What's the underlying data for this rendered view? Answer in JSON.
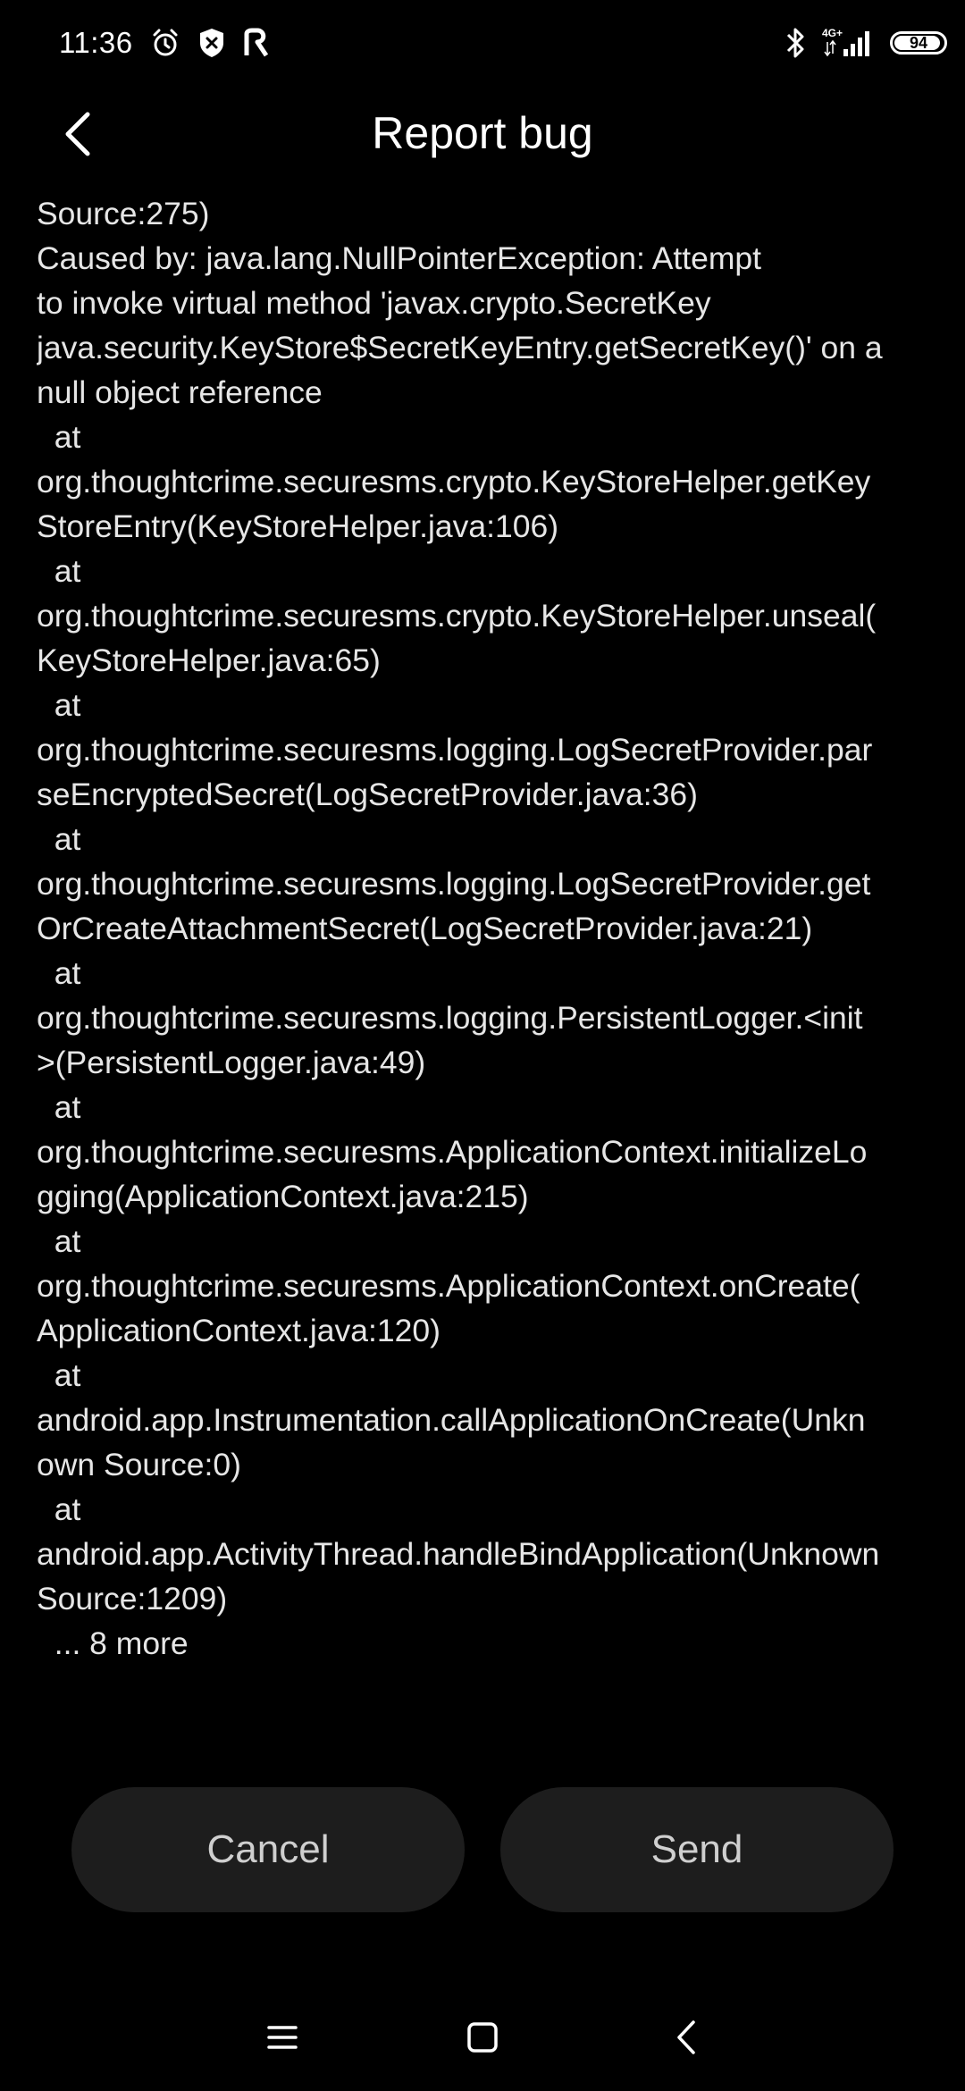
{
  "status_bar": {
    "time": "11:36",
    "battery_level": "94",
    "network": "4G+",
    "left_icons": [
      "alarm-icon",
      "shield-icon",
      "app-icon"
    ],
    "right_icons": [
      "bluetooth-icon",
      "signal-icon",
      "battery-icon"
    ]
  },
  "header": {
    "title": "Report bug",
    "back_icon": "chevron-left-icon"
  },
  "log": {
    "lines": [
      "Source:275)",
      "Caused by: java.lang.NullPointerException: Attempt",
      "to invoke virtual method 'javax.crypto.SecretKey",
      "java.security.KeyStore$SecretKeyEntry.getSecretKey()' on a",
      "null object reference",
      "  at",
      "org.thoughtcrime.securesms.crypto.KeyStoreHelper.getKey",
      "StoreEntry(KeyStoreHelper.java:106)",
      "  at",
      "org.thoughtcrime.securesms.crypto.KeyStoreHelper.unseal(",
      "KeyStoreHelper.java:65)",
      "  at",
      "org.thoughtcrime.securesms.logging.LogSecretProvider.par",
      "seEncryptedSecret(LogSecretProvider.java:36)",
      "  at",
      "org.thoughtcrime.securesms.logging.LogSecretProvider.get",
      "OrCreateAttachmentSecret(LogSecretProvider.java:21)",
      "  at",
      "org.thoughtcrime.securesms.logging.PersistentLogger.<init",
      ">(PersistentLogger.java:49)",
      "  at",
      "org.thoughtcrime.securesms.ApplicationContext.initializeLo",
      "gging(ApplicationContext.java:215)",
      "  at",
      "org.thoughtcrime.securesms.ApplicationContext.onCreate(",
      "ApplicationContext.java:120)",
      "  at",
      "android.app.Instrumentation.callApplicationOnCreate(Unkn",
      "own Source:0)",
      "  at",
      "android.app.ActivityThread.handleBindApplication(Unknown",
      "Source:1209)",
      "  ... 8 more"
    ]
  },
  "buttons": {
    "cancel_label": "Cancel",
    "send_label": "Send"
  },
  "nav_bar": {
    "icons": [
      "menu-icon",
      "home-icon",
      "back-icon"
    ]
  },
  "colors": {
    "background": "#000000",
    "text": "#e6e6e6",
    "button_bg": "#1d1d1d",
    "button_text": "#cfcfcf"
  }
}
